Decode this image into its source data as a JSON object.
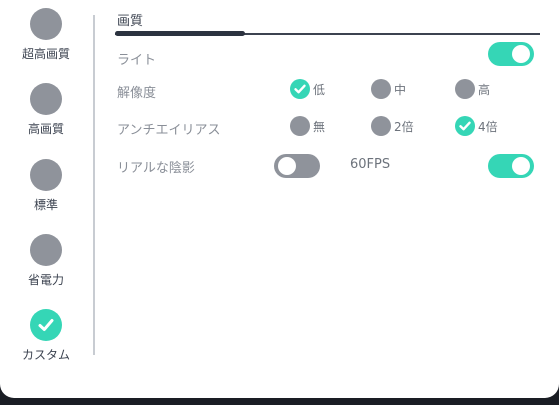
{
  "colors": {
    "accent": "#35d6b6",
    "inactive": "#8f939b",
    "text": "#3c4350",
    "muted": "#8a8f98"
  },
  "sidebar": {
    "presets": [
      {
        "label": "超高画質",
        "selected": false
      },
      {
        "label": "高画質",
        "selected": false
      },
      {
        "label": "標準",
        "selected": false
      },
      {
        "label": "省電力",
        "selected": false
      },
      {
        "label": "カスタム",
        "selected": true
      }
    ]
  },
  "section": {
    "title": "画質"
  },
  "settings": {
    "light": {
      "label": "ライト",
      "enabled": true
    },
    "resolution": {
      "label": "解像度",
      "options": [
        {
          "label": "低",
          "selected": true
        },
        {
          "label": "中",
          "selected": false
        },
        {
          "label": "高",
          "selected": false
        }
      ]
    },
    "antialiasing": {
      "label": "アンチエイリアス",
      "options": [
        {
          "label": "無",
          "selected": false
        },
        {
          "label": "2倍",
          "selected": false
        },
        {
          "label": "4倍",
          "selected": true
        }
      ]
    },
    "realistic_shadows": {
      "label": "リアルな陰影",
      "enabled": false
    },
    "fps60": {
      "label": "60FPS",
      "enabled": true
    }
  }
}
